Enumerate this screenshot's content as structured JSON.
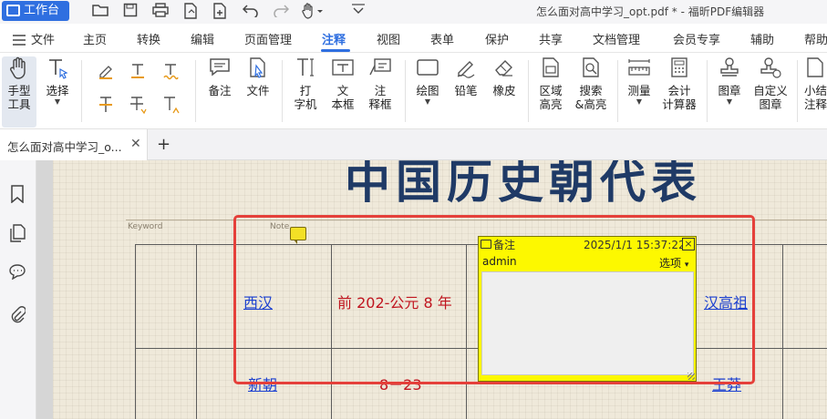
{
  "titlebar": {
    "workbench_label": "工作台",
    "window_title": "怎么面对高中学习_opt.pdf * - 福昕PDF编辑器",
    "tools": [
      "open-folder-icon",
      "save-icon",
      "print-icon",
      "export-icon",
      "new-icon",
      "undo-icon",
      "redo-icon",
      "hand-icon",
      "customize-icon"
    ]
  },
  "menu": {
    "items": [
      "文件",
      "主页",
      "转换",
      "编辑",
      "页面管理",
      "注释",
      "视图",
      "表单",
      "保护",
      "共享",
      "文档管理",
      "会员专享",
      "辅助",
      "帮助"
    ],
    "active": "注释"
  },
  "ribbon": {
    "hand_tool": "手型\n工具",
    "select": "选择",
    "note": "备注",
    "file": "文件",
    "typewriter": "打\n字机",
    "textbox": "文\n本框",
    "callout": "注\n释框",
    "drawing": "绘图",
    "pencil": "铅笔",
    "eraser": "橡皮",
    "area_highlight": "区域\n高亮",
    "search_highlight": "搜索\n&高亮",
    "measure": "测量",
    "calculator": "会计\n计算器",
    "stamp": "图章",
    "custom_stamp": "自定义\n图章",
    "summary": "小结\n注释"
  },
  "tabs": {
    "doc_tab": "怎么面对高中学习_o..."
  },
  "document": {
    "title": "中国历史朝代表",
    "keyword_label": "Keyword",
    "note_label": "Note",
    "rows": [
      {
        "dynasty": "西汉",
        "period": "前 202-公元 8 年",
        "founder": "汉高祖"
      },
      {
        "dynasty": "新朝",
        "period": "8－23",
        "founder": "王莽"
      }
    ]
  },
  "note_popup": {
    "label": "备注",
    "timestamp": "2025/1/1 15:37:22",
    "author": "admin",
    "options": "选项",
    "close": "×",
    "caret": "▾"
  },
  "colors": {
    "accent": "#2f6fe0",
    "selection_border": "#e5403a",
    "note_yellow": "#fdf800",
    "title_navy": "#1f3a66",
    "link_blue": "#1a3fd0",
    "text_red": "#c0151f"
  }
}
